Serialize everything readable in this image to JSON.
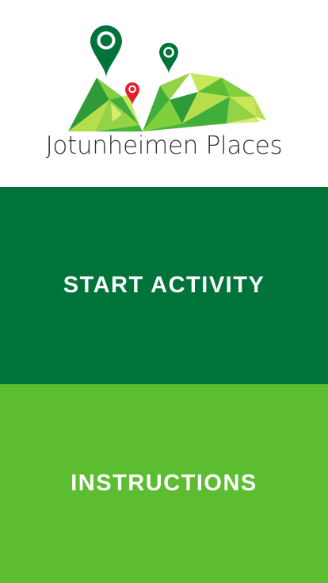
{
  "app": {
    "name": "Jotunheimen Places"
  },
  "menu": {
    "start_activity_label": "START ACTIVITY",
    "instructions_label": "INSTRUCTIONS"
  },
  "colors": {
    "dark_green": "#00733b",
    "light_green": "#5bbd2f",
    "lime": "#c8e65a",
    "pin_red": "#e5202e"
  },
  "icons": {
    "logo": "mountains-with-map-pins"
  }
}
